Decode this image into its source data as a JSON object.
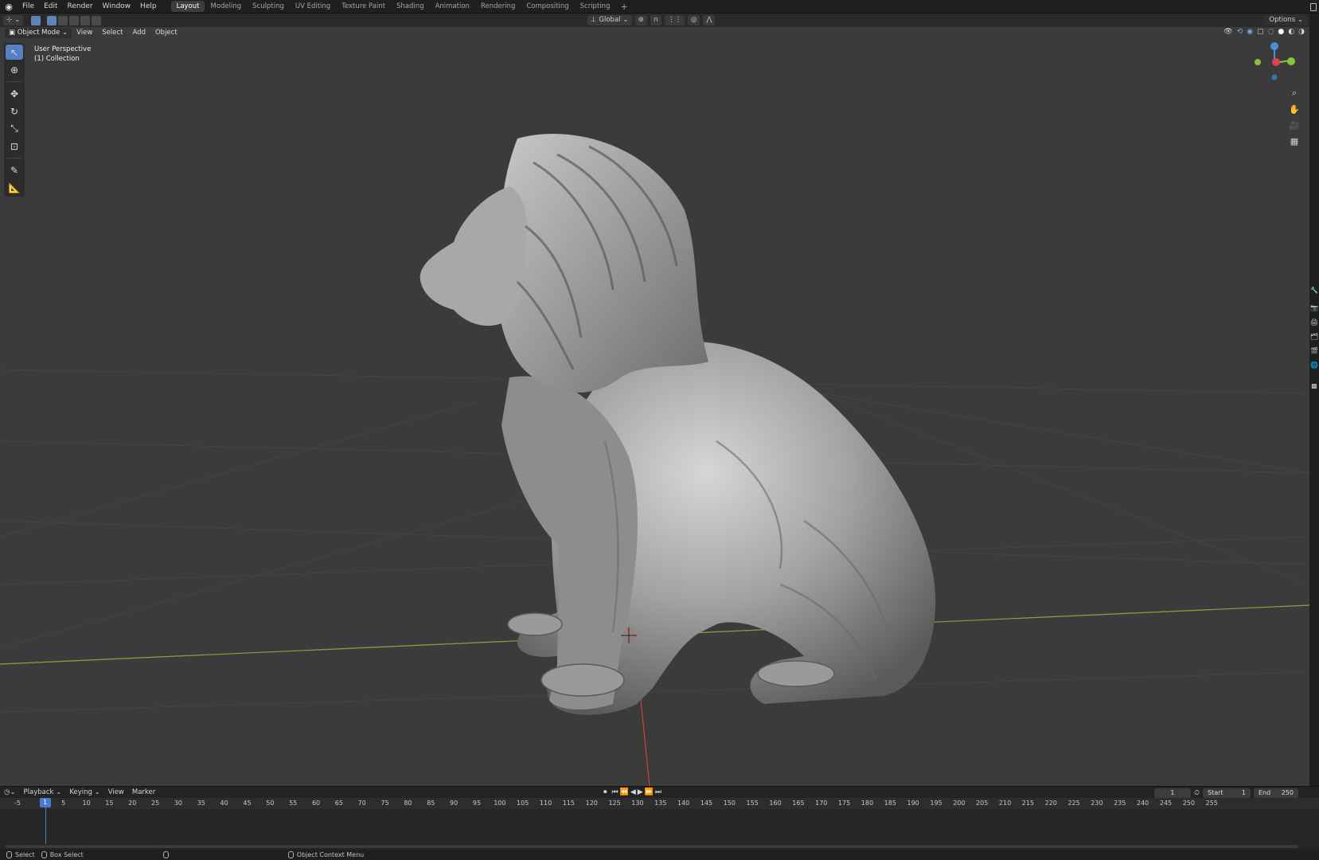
{
  "menu": {
    "logo_icon": "blender-icon",
    "items": [
      "File",
      "Edit",
      "Render",
      "Window",
      "Help"
    ]
  },
  "workspaces": {
    "tabs": [
      "Layout",
      "Modeling",
      "Sculpting",
      "UV Editing",
      "Texture Paint",
      "Shading",
      "Animation",
      "Rendering",
      "Compositing",
      "Scripting"
    ],
    "active": "Layout",
    "add_label": "+"
  },
  "tool_header": {
    "transform_orientation": "Global",
    "options_label": "Options"
  },
  "viewport_header": {
    "mode": "Object Mode",
    "menus": [
      "View",
      "Select",
      "Add",
      "Object"
    ]
  },
  "viewport": {
    "perspective_label": "User Perspective",
    "collection_label": "(1) Collection",
    "object": "lion-sculpture",
    "colors": {
      "background": "#3b3b3b",
      "x_axis": "#c24545",
      "y_axis": "#7fa83a",
      "grid": "#474747"
    }
  },
  "gizmo": {
    "axes": [
      "Z",
      "X",
      "Y"
    ],
    "colors": {
      "x": "#e0434b",
      "y": "#8ac33d",
      "z": "#4b8ed9"
    }
  },
  "timeline": {
    "menus": [
      "Playback",
      "Keying",
      "View",
      "Marker"
    ],
    "ticks": [
      -5,
      5,
      10,
      15,
      20,
      25,
      30,
      35,
      40,
      45,
      50,
      55,
      60,
      65,
      70,
      75,
      80,
      85,
      90,
      95,
      100,
      105,
      110,
      115,
      120,
      125,
      130,
      135,
      140,
      145,
      150,
      155,
      160,
      165,
      170,
      175,
      180,
      185,
      190,
      195,
      200,
      205,
      210,
      215,
      220,
      225,
      230,
      235,
      240,
      245,
      250,
      255
    ],
    "current_frame": "1",
    "current_frame_field": "1",
    "start_label": "Start",
    "start_value": "1",
    "end_label": "End",
    "end_value": "250"
  },
  "status": {
    "select": "Select",
    "box_select": "Box Select",
    "context_menu": "Object Context Menu"
  }
}
